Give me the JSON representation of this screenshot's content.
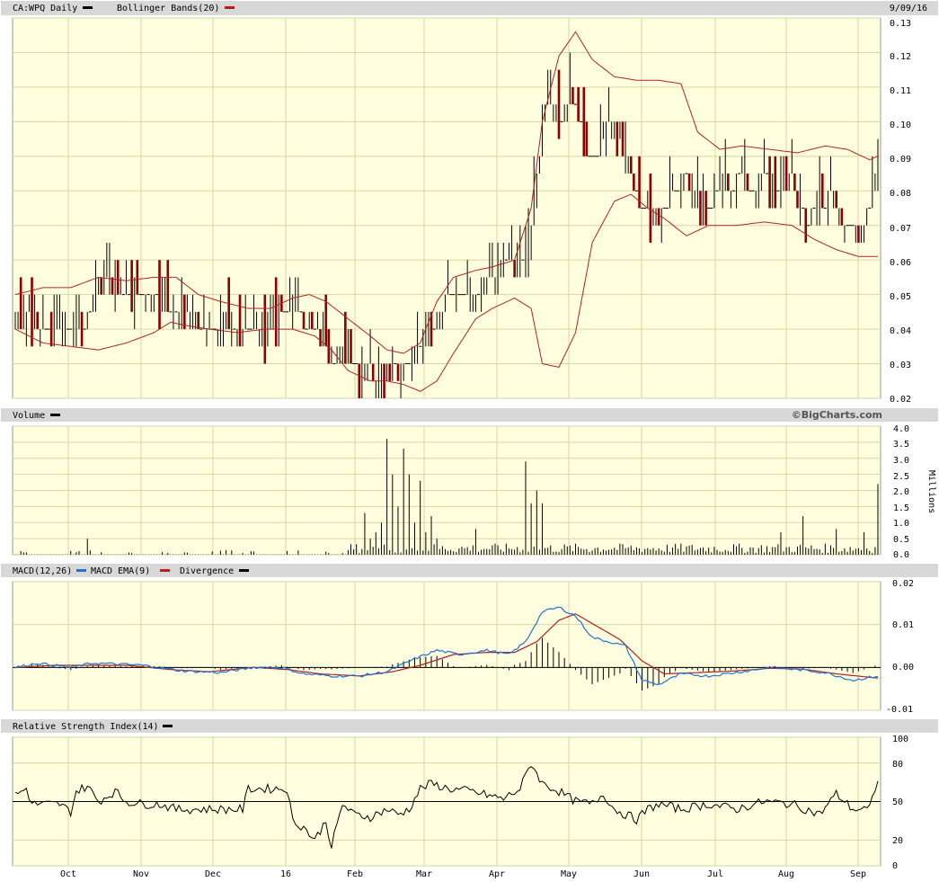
{
  "header": {
    "symbol_label": "CA:WPQ Daily",
    "bollinger_label": "Bollinger Bands(20)",
    "date": "9/09/16"
  },
  "panels": {
    "volume_label": "Volume",
    "brand": "©BigCharts.com",
    "volume_unit": "Millions",
    "macd_label": "MACD(12,26)",
    "macd_ema_label": "MACD EMA(9)",
    "divergence_label": "Divergence",
    "rsi_label": "Relative Strength Index(14)"
  },
  "colors": {
    "panel_bg": "#ffffe0",
    "grid": "#d6d6a0",
    "header_bg": "#d8d8d8",
    "price_up": "#000000",
    "price_down": "#8b0000",
    "bollinger": "#b22222",
    "macd": "#1e73d8",
    "macd_ema": "#b22222"
  },
  "chart_data": [
    {
      "type": "ohlc",
      "title": "CA:WPQ Daily",
      "ylim": [
        0.02,
        0.13
      ],
      "y_ticks": [
        "0.02",
        "0.03",
        "0.04",
        "0.05",
        "0.06",
        "0.07",
        "0.08",
        "0.09",
        "0.10",
        "0.11",
        "0.12",
        "0.13"
      ],
      "x_ticks": [
        "Oct",
        "Nov",
        "Dec",
        "16",
        "Feb",
        "Mar",
        "Apr",
        "May",
        "Jun",
        "Jul",
        "Aug",
        "Sep"
      ],
      "close_anchors": [
        [
          0,
          0.045
        ],
        [
          10,
          0.04
        ],
        [
          20,
          0.04
        ],
        [
          25,
          0.042
        ],
        [
          28,
          0.05
        ],
        [
          32,
          0.055
        ],
        [
          40,
          0.05
        ],
        [
          50,
          0.05
        ],
        [
          60,
          0.045
        ],
        [
          70,
          0.04
        ],
        [
          80,
          0.04
        ],
        [
          90,
          0.04
        ],
        [
          95,
          0.045
        ],
        [
          102,
          0.045
        ],
        [
          108,
          0.04
        ],
        [
          112,
          0.035
        ],
        [
          118,
          0.035
        ],
        [
          124,
          0.03
        ],
        [
          130,
          0.028
        ],
        [
          136,
          0.03
        ],
        [
          142,
          0.03
        ],
        [
          148,
          0.04
        ],
        [
          152,
          0.045
        ],
        [
          156,
          0.05
        ],
        [
          160,
          0.05
        ],
        [
          166,
          0.05
        ],
        [
          172,
          0.055
        ],
        [
          176,
          0.06
        ],
        [
          180,
          0.055
        ],
        [
          184,
          0.06
        ],
        [
          186,
          0.07
        ],
        [
          189,
          0.09
        ],
        [
          192,
          0.11
        ],
        [
          196,
          0.1
        ],
        [
          200,
          0.11
        ],
        [
          205,
          0.095
        ],
        [
          210,
          0.09
        ],
        [
          215,
          0.1
        ],
        [
          220,
          0.09
        ],
        [
          224,
          0.08
        ],
        [
          228,
          0.075
        ],
        [
          232,
          0.07
        ],
        [
          236,
          0.08
        ],
        [
          240,
          0.085
        ],
        [
          245,
          0.08
        ],
        [
          250,
          0.075
        ],
        [
          255,
          0.08
        ],
        [
          260,
          0.085
        ],
        [
          265,
          0.08
        ],
        [
          270,
          0.085
        ],
        [
          275,
          0.08
        ],
        [
          280,
          0.085
        ],
        [
          285,
          0.07
        ],
        [
          290,
          0.08
        ],
        [
          295,
          0.075
        ],
        [
          300,
          0.07
        ],
        [
          305,
          0.07
        ],
        [
          308,
          0.075
        ],
        [
          311,
          0.09
        ]
      ],
      "bollinger": {
        "upper": [
          [
            0,
            0.05
          ],
          [
            10,
            0.052
          ],
          [
            20,
            0.052
          ],
          [
            30,
            0.055
          ],
          [
            40,
            0.054
          ],
          [
            50,
            0.055
          ],
          [
            58,
            0.055
          ],
          [
            66,
            0.05
          ],
          [
            74,
            0.048
          ],
          [
            84,
            0.046
          ],
          [
            92,
            0.046
          ],
          [
            100,
            0.049
          ],
          [
            106,
            0.05
          ],
          [
            112,
            0.048
          ],
          [
            120,
            0.043
          ],
          [
            128,
            0.038
          ],
          [
            134,
            0.034
          ],
          [
            140,
            0.033
          ],
          [
            146,
            0.036
          ],
          [
            152,
            0.048
          ],
          [
            158,
            0.055
          ],
          [
            166,
            0.057
          ],
          [
            172,
            0.058
          ],
          [
            180,
            0.06
          ],
          [
            186,
            0.075
          ],
          [
            190,
            0.1
          ],
          [
            196,
            0.119
          ],
          [
            202,
            0.126
          ],
          [
            208,
            0.118
          ],
          [
            216,
            0.113
          ],
          [
            224,
            0.112
          ],
          [
            232,
            0.112
          ],
          [
            240,
            0.111
          ],
          [
            246,
            0.097
          ],
          [
            254,
            0.092
          ],
          [
            262,
            0.093
          ],
          [
            272,
            0.092
          ],
          [
            282,
            0.091
          ],
          [
            292,
            0.093
          ],
          [
            300,
            0.092
          ],
          [
            308,
            0.089
          ],
          [
            311,
            0.09
          ]
        ],
        "lower": [
          [
            0,
            0.04
          ],
          [
            10,
            0.036
          ],
          [
            20,
            0.035
          ],
          [
            30,
            0.034
          ],
          [
            40,
            0.036
          ],
          [
            50,
            0.039
          ],
          [
            56,
            0.042
          ],
          [
            62,
            0.041
          ],
          [
            70,
            0.04
          ],
          [
            80,
            0.039
          ],
          [
            90,
            0.04
          ],
          [
            100,
            0.04
          ],
          [
            108,
            0.038
          ],
          [
            114,
            0.034
          ],
          [
            120,
            0.028
          ],
          [
            128,
            0.025
          ],
          [
            134,
            0.025
          ],
          [
            140,
            0.024
          ],
          [
            146,
            0.022
          ],
          [
            152,
            0.025
          ],
          [
            158,
            0.033
          ],
          [
            166,
            0.043
          ],
          [
            172,
            0.046
          ],
          [
            180,
            0.049
          ],
          [
            186,
            0.046
          ],
          [
            190,
            0.03
          ],
          [
            196,
            0.029
          ],
          [
            202,
            0.039
          ],
          [
            208,
            0.065
          ],
          [
            216,
            0.077
          ],
          [
            222,
            0.079
          ],
          [
            228,
            0.075
          ],
          [
            234,
            0.072
          ],
          [
            242,
            0.067
          ],
          [
            250,
            0.07
          ],
          [
            260,
            0.07
          ],
          [
            270,
            0.071
          ],
          [
            280,
            0.07
          ],
          [
            288,
            0.066
          ],
          [
            296,
            0.063
          ],
          [
            304,
            0.061
          ],
          [
            311,
            0.061
          ]
        ]
      }
    },
    {
      "type": "bar",
      "title": "Volume",
      "ylabel": "Millions",
      "ylim": [
        0,
        4.0
      ],
      "y_ticks": [
        "0.0",
        "0.5",
        "1.0",
        "1.5",
        "2.0",
        "2.5",
        "3.0",
        "3.5",
        "4.0"
      ],
      "spikes": [
        [
          26,
          0.5
        ],
        [
          126,
          1.3
        ],
        [
          128,
          0.5
        ],
        [
          130,
          0.7
        ],
        [
          132,
          1.0
        ],
        [
          134,
          3.6
        ],
        [
          136,
          2.5
        ],
        [
          138,
          1.5
        ],
        [
          140,
          3.3
        ],
        [
          142,
          2.5
        ],
        [
          144,
          1.0
        ],
        [
          146,
          2.3
        ],
        [
          148,
          0.7
        ],
        [
          150,
          1.2
        ],
        [
          152,
          0.5
        ],
        [
          166,
          0.8
        ],
        [
          184,
          2.9
        ],
        [
          186,
          1.6
        ],
        [
          188,
          2.0
        ],
        [
          190,
          1.6
        ],
        [
          276,
          0.7
        ],
        [
          284,
          1.2
        ],
        [
          296,
          0.8
        ],
        [
          306,
          0.7
        ],
        [
          311,
          2.2
        ]
      ]
    },
    {
      "type": "line",
      "title": "MACD(12,26)",
      "ylim": [
        -0.01,
        0.02
      ],
      "y_ticks": [
        "-0.01",
        "0.00",
        "0.01",
        "0.02"
      ],
      "series": [
        {
          "name": "MACD(12,26)",
          "points": [
            [
              0,
              0.0
            ],
            [
              8,
              0.001
            ],
            [
              20,
              0.0
            ],
            [
              28,
              0.001
            ],
            [
              36,
              0.0008
            ],
            [
              46,
              0.0005
            ],
            [
              60,
              -0.0008
            ],
            [
              74,
              -0.0012
            ],
            [
              86,
              0.0
            ],
            [
              96,
              0.0
            ],
            [
              104,
              -0.0015
            ],
            [
              114,
              -0.002
            ],
            [
              124,
              -0.002
            ],
            [
              134,
              -0.001
            ],
            [
              144,
              0.002
            ],
            [
              152,
              0.004
            ],
            [
              160,
              0.003
            ],
            [
              170,
              0.004
            ],
            [
              178,
              0.003
            ],
            [
              184,
              0.006
            ],
            [
              190,
              0.013
            ],
            [
              196,
              0.014
            ],
            [
              202,
              0.012
            ],
            [
              208,
              0.007
            ],
            [
              214,
              0.006
            ],
            [
              220,
              0.005
            ],
            [
              226,
              -0.003
            ],
            [
              232,
              -0.004
            ],
            [
              240,
              -0.0015
            ],
            [
              250,
              -0.002
            ],
            [
              262,
              -0.001
            ],
            [
              272,
              0.0
            ],
            [
              282,
              -0.0005
            ],
            [
              292,
              -0.0012
            ],
            [
              302,
              -0.003
            ],
            [
              311,
              -0.002
            ]
          ]
        },
        {
          "name": "MACD EMA(9)",
          "points": [
            [
              0,
              0.0
            ],
            [
              14,
              0.0005
            ],
            [
              26,
              0.0005
            ],
            [
              40,
              0.0005
            ],
            [
              56,
              -0.0005
            ],
            [
              70,
              -0.001
            ],
            [
              86,
              0.0
            ],
            [
              98,
              -0.0005
            ],
            [
              110,
              -0.0015
            ],
            [
              124,
              -0.002
            ],
            [
              136,
              -0.001
            ],
            [
              146,
              0.0005
            ],
            [
              158,
              0.003
            ],
            [
              170,
              0.0035
            ],
            [
              180,
              0.0035
            ],
            [
              188,
              0.006
            ],
            [
              196,
              0.011
            ],
            [
              202,
              0.0125
            ],
            [
              210,
              0.0095
            ],
            [
              218,
              0.0065
            ],
            [
              226,
              0.0015
            ],
            [
              234,
              -0.0015
            ],
            [
              246,
              -0.0012
            ],
            [
              260,
              -0.0008
            ],
            [
              272,
              -0.0002
            ],
            [
              284,
              -0.0004
            ],
            [
              296,
              -0.0015
            ],
            [
              311,
              -0.0025
            ]
          ]
        }
      ]
    },
    {
      "type": "line",
      "title": "Relative Strength Index(14)",
      "ylim": [
        0,
        100
      ],
      "y_ticks": [
        "0",
        "20",
        "50",
        "80",
        "100"
      ],
      "reference_line": 50,
      "series": [
        {
          "name": "Relative Strength Index(14)",
          "points": [
            [
              0,
              55
            ],
            [
              4,
              60
            ],
            [
              6,
              48
            ],
            [
              16,
              48
            ],
            [
              20,
              42
            ],
            [
              22,
              58
            ],
            [
              26,
              62
            ],
            [
              30,
              50
            ],
            [
              36,
              58
            ],
            [
              40,
              50
            ],
            [
              46,
              48
            ],
            [
              52,
              48
            ],
            [
              58,
              44
            ],
            [
              70,
              44
            ],
            [
              82,
              44
            ],
            [
              84,
              60
            ],
            [
              98,
              60
            ],
            [
              100,
              35
            ],
            [
              104,
              30
            ],
            [
              106,
              25
            ],
            [
              108,
              20
            ],
            [
              112,
              35
            ],
            [
              114,
              15
            ],
            [
              118,
              48
            ],
            [
              122,
              40
            ],
            [
              128,
              38
            ],
            [
              134,
              44
            ],
            [
              138,
              40
            ],
            [
              142,
              44
            ],
            [
              146,
              60
            ],
            [
              150,
              64
            ],
            [
              156,
              60
            ],
            [
              164,
              58
            ],
            [
              170,
              55
            ],
            [
              176,
              52
            ],
            [
              182,
              60
            ],
            [
              186,
              80
            ],
            [
              190,
              64
            ],
            [
              196,
              58
            ],
            [
              202,
              50
            ],
            [
              208,
              48
            ],
            [
              212,
              56
            ],
            [
              216,
              44
            ],
            [
              224,
              36
            ],
            [
              228,
              44
            ],
            [
              232,
              48
            ],
            [
              240,
              44
            ],
            [
              250,
              48
            ],
            [
              260,
              44
            ],
            [
              270,
              50
            ],
            [
              280,
              48
            ],
            [
              290,
              40
            ],
            [
              296,
              56
            ],
            [
              302,
              44
            ],
            [
              308,
              44
            ],
            [
              311,
              68
            ]
          ]
        }
      ]
    }
  ]
}
